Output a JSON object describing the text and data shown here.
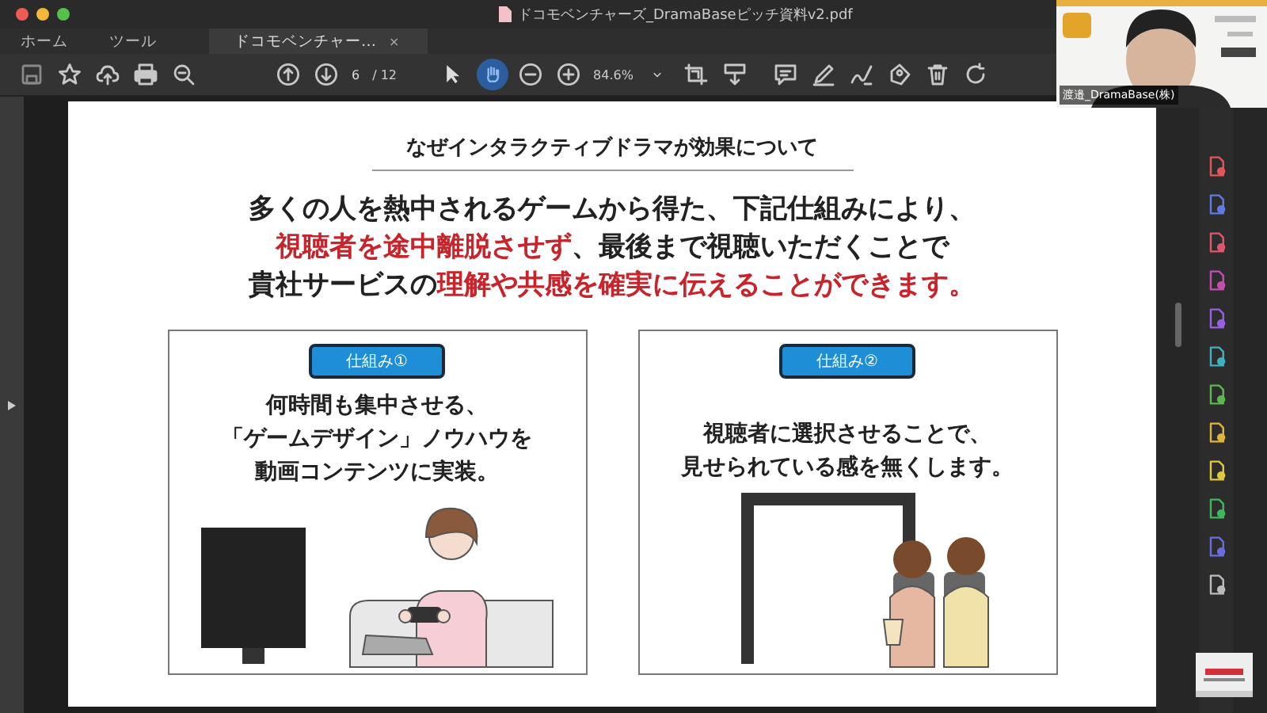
{
  "window": {
    "title": "ドコモベンチャーズ_DramaBaseピッチ資料v2.pdf"
  },
  "tabs": [
    {
      "label": "ホーム",
      "selected": false
    },
    {
      "label": "ツール",
      "selected": false
    },
    {
      "label": "ドコモベンチャー…",
      "selected": true,
      "close": "×"
    }
  ],
  "toolbar": {
    "page": "6",
    "pages": "/ 12",
    "zoom": "84.6%",
    "tools": [
      {
        "kind": "pointer",
        "selected": false
      },
      {
        "kind": "hand",
        "selected": true
      }
    ]
  },
  "slide": {
    "title": "なぜインタラクティブドラマが効果について",
    "lines": [
      [
        {
          "text": "多くの人を熱中されるゲームから得た、下記仕組みにより、",
          "emphasis": false
        }
      ],
      [
        {
          "text": "視聴者を途中離脱させず",
          "emphasis": true
        },
        {
          "text": "、最後まで視聴いただくことで",
          "emphasis": false
        }
      ],
      [
        {
          "text": "貴社サービスの",
          "emphasis": false
        },
        {
          "text": "理解や共感を確実に伝えることができます。",
          "emphasis": true
        }
      ]
    ],
    "cards": [
      {
        "badge": "仕組み①",
        "lines": [
          "何時間も集中させる、",
          "「ゲームデザイン」ノウハウを",
          "動画コンテンツに実装。"
        ],
        "kind": "gamer"
      },
      {
        "badge": "仕組み②",
        "lines": [
          "視聴者に選択させることで、",
          "見せられている感を無くします。"
        ],
        "kind": "viewers"
      }
    ]
  },
  "video": {
    "name": "渡邉_DramaBase(株)"
  }
}
